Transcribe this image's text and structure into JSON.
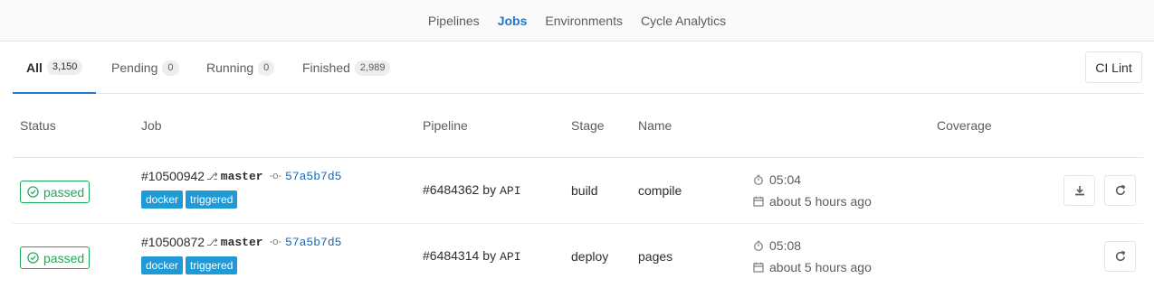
{
  "subnav": {
    "items": [
      {
        "label": "Pipelines"
      },
      {
        "label": "Jobs"
      },
      {
        "label": "Environments"
      },
      {
        "label": "Cycle Analytics"
      }
    ]
  },
  "scope_tabs": [
    {
      "label": "All",
      "count": "3,150"
    },
    {
      "label": "Pending",
      "count": "0"
    },
    {
      "label": "Running",
      "count": "0"
    },
    {
      "label": "Finished",
      "count": "2,989"
    }
  ],
  "ci_lint_label": "CI Lint",
  "table": {
    "headers": {
      "status": "Status",
      "job": "Job",
      "pipeline": "Pipeline",
      "stage": "Stage",
      "name": "Name",
      "coverage": "Coverage"
    },
    "rows": [
      {
        "status": "passed",
        "job_id": "#10500942",
        "ref": "master",
        "sha": "57a5b7d5",
        "labels": [
          "docker",
          "triggered"
        ],
        "pipeline_id": "#6484362",
        "by": "by",
        "user": "API",
        "stage": "build",
        "name": "compile",
        "duration": "05:04",
        "finished": "about 5 hours ago",
        "has_download": true
      },
      {
        "status": "passed",
        "job_id": "#10500872",
        "ref": "master",
        "sha": "57a5b7d5",
        "labels": [
          "docker",
          "triggered"
        ],
        "pipeline_id": "#6484314",
        "by": "by",
        "user": "API",
        "stage": "deploy",
        "name": "pages",
        "duration": "05:08",
        "finished": "about 5 hours ago",
        "has_download": false
      }
    ]
  },
  "colors": {
    "accent": "#1f78d1",
    "success": "#1aaa55",
    "label_bg": "#1f9ad7",
    "sha_link": "#1b69b6"
  },
  "icons": {
    "status": "check-circle-icon",
    "branch": "branch-icon",
    "commit": "commit-icon",
    "timer": "timer-icon",
    "calendar": "calendar-icon",
    "download": "download-icon",
    "retry": "retry-icon"
  }
}
